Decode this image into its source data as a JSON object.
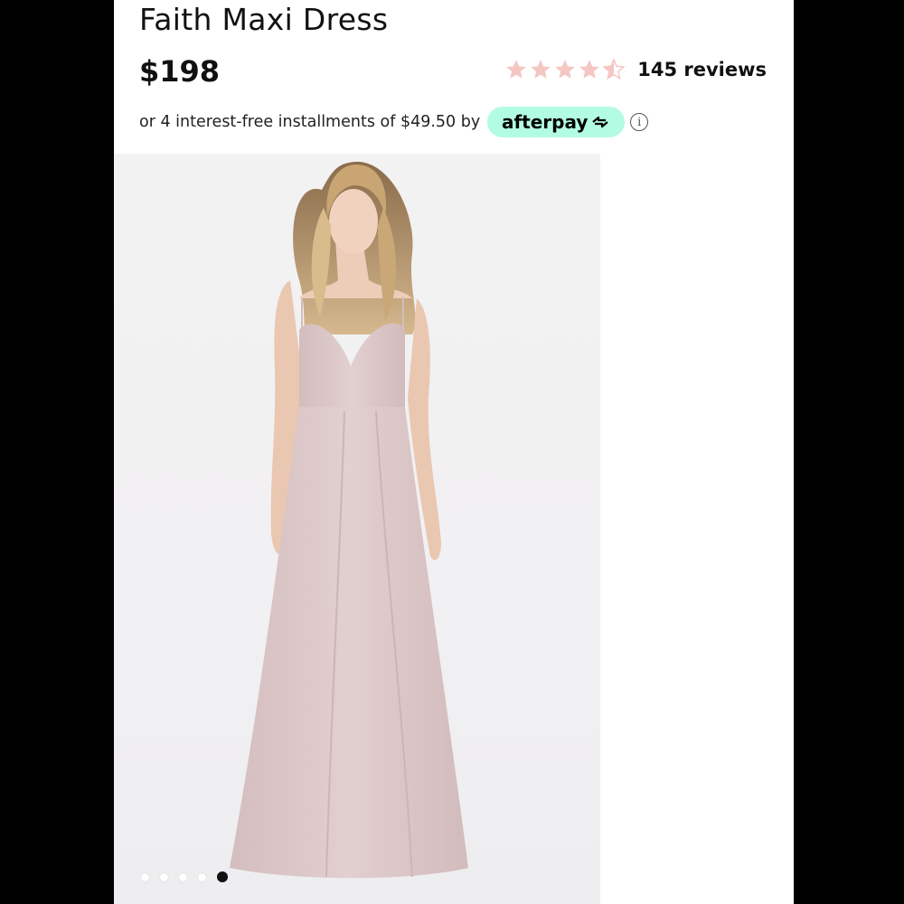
{
  "product": {
    "title": "Faith Maxi Dress",
    "price": "$198",
    "rating_value": 4.5,
    "rating_max": 5,
    "reviews_label": "145 reviews",
    "star_color": "#f4c7c3"
  },
  "afterpay": {
    "text": "or 4 interest-free installments of $49.50 by",
    "brand": "afterpay",
    "badge_color": "#b2fce4",
    "info_glyph": "i"
  },
  "gallery": {
    "total_images": 5,
    "active_index": 4,
    "dress_color": "#dcc7c8"
  }
}
